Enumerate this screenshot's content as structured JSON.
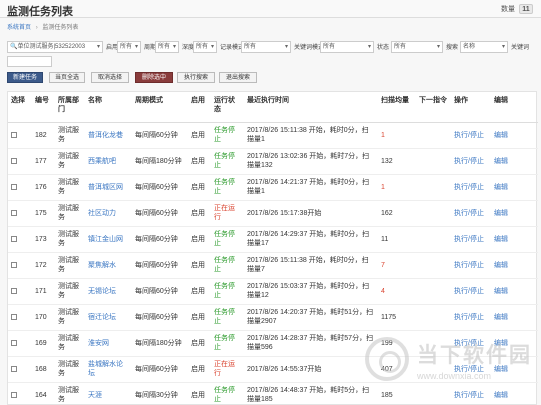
{
  "header": {
    "title": "监测任务列表",
    "count_label": "数量",
    "count_value": "11"
  },
  "breadcrumb": {
    "home": "系统首页",
    "separator": "›",
    "current": "监测任务列表"
  },
  "filters": {
    "unit_value": "单位测试服务|532522003",
    "enable_label": "启用",
    "enable_value": "所有",
    "cycle_label": "周期",
    "cycle_value": "所有",
    "depth_label": "深度",
    "depth_value": "所有",
    "record_label": "记录模式",
    "record_value": "所有",
    "keyword_label": "关键词模式",
    "keyword_value": "所有",
    "status_label": "状态",
    "status_value": "所有",
    "search_label": "搜索",
    "search_value": "名称",
    "keyword_input_label": "关键词"
  },
  "toolbar": {
    "new_task": "新建任务",
    "select_all": "当页全选",
    "cancel_select": "取消选择",
    "delete_selected": "删除选中",
    "run_search": "执行搜索",
    "exit_search": "退出搜索"
  },
  "table": {
    "headers": [
      "选择",
      "编号",
      "所属部门",
      "名称",
      "周期模式",
      "启用",
      "运行状态",
      "最近执行时间",
      "扫描均量",
      "下一指令",
      "操作",
      "编辑"
    ],
    "op_label": "执行/停止",
    "edit_label": "编辑",
    "rows": [
      {
        "id": "182",
        "dept": "测试服务",
        "name": "普洱化龙巷",
        "cycle": "每间隔60分钟",
        "enabled": "启用",
        "status": "任务停止",
        "status_type": "stopped",
        "time": "2017/8/26 15:11:38 开始，耗时0分，扫描量1",
        "scan": "1",
        "scan_red": true
      },
      {
        "id": "177",
        "dept": "测试服务",
        "name": "西乘航吧",
        "cycle": "每间隔180分钟",
        "enabled": "启用",
        "status": "任务停止",
        "status_type": "stopped",
        "time": "2017/8/26 13:02:36 开始，耗时7分，扫描量132",
        "scan": "132",
        "scan_red": false
      },
      {
        "id": "176",
        "dept": "测试服务",
        "name": "普洱城区网",
        "cycle": "每间隔60分钟",
        "enabled": "启用",
        "status": "任务停止",
        "status_type": "stopped",
        "time": "2017/8/26 14:21:37 开始，耗时0分，扫描量1",
        "scan": "1",
        "scan_red": true
      },
      {
        "id": "175",
        "dept": "测试服务",
        "name": "社区动力",
        "cycle": "每间隔60分钟",
        "enabled": "启用",
        "status": "正在运行",
        "status_type": "running",
        "time": "2017/8/26 15:17:38开始",
        "scan": "162",
        "scan_red": false
      },
      {
        "id": "173",
        "dept": "测试服务",
        "name": "镇江金山网",
        "cycle": "每间隔60分钟",
        "enabled": "启用",
        "status": "任务停止",
        "status_type": "stopped",
        "time": "2017/8/26 14:29:37 开始，耗时0分，扫描量17",
        "scan": "11",
        "scan_red": false
      },
      {
        "id": "172",
        "dept": "测试服务",
        "name": "聚焦解水",
        "cycle": "每间隔60分钟",
        "enabled": "启用",
        "status": "任务停止",
        "status_type": "stopped",
        "time": "2017/8/26 15:11:38 开始，耗时0分，扫描量7",
        "scan": "7",
        "scan_red": true
      },
      {
        "id": "171",
        "dept": "测试服务",
        "name": "无锡论坛",
        "cycle": "每间隔60分钟",
        "enabled": "启用",
        "status": "任务停止",
        "status_type": "stopped",
        "time": "2017/8/26 15:03:37 开始，耗时0分，扫描量12",
        "scan": "4",
        "scan_red": true
      },
      {
        "id": "170",
        "dept": "测试服务",
        "name": "宿迁论坛",
        "cycle": "每间隔60分钟",
        "enabled": "启用",
        "status": "任务停止",
        "status_type": "stopped",
        "time": "2017/8/26 14:20:37 开始，耗时51分，扫描量2907",
        "scan": "1175",
        "scan_red": false
      },
      {
        "id": "169",
        "dept": "测试服务",
        "name": "淮安网",
        "cycle": "每间隔180分钟",
        "enabled": "启用",
        "status": "任务停止",
        "status_type": "stopped",
        "time": "2017/8/26 14:28:37 开始，耗时57分，扫描量596",
        "scan": "199",
        "scan_red": false
      },
      {
        "id": "168",
        "dept": "测试服务",
        "name": "盐城解水论坛",
        "cycle": "每间隔60分钟",
        "enabled": "启用",
        "status": "正在运行",
        "status_type": "running",
        "time": "2017/8/26 14:55:37开始",
        "scan": "407",
        "scan_red": false
      },
      {
        "id": "164",
        "dept": "测试服务",
        "name": "天涯",
        "cycle": "每间隔30分钟",
        "enabled": "启用",
        "status": "任务停止",
        "status_type": "stopped",
        "time": "2017/8/26 14:48:37 开始，耗时5分，扫描量185",
        "scan": "185",
        "scan_red": false
      }
    ]
  },
  "watermark": {
    "name": "当下软件园",
    "url": "www.downxia.com"
  }
}
